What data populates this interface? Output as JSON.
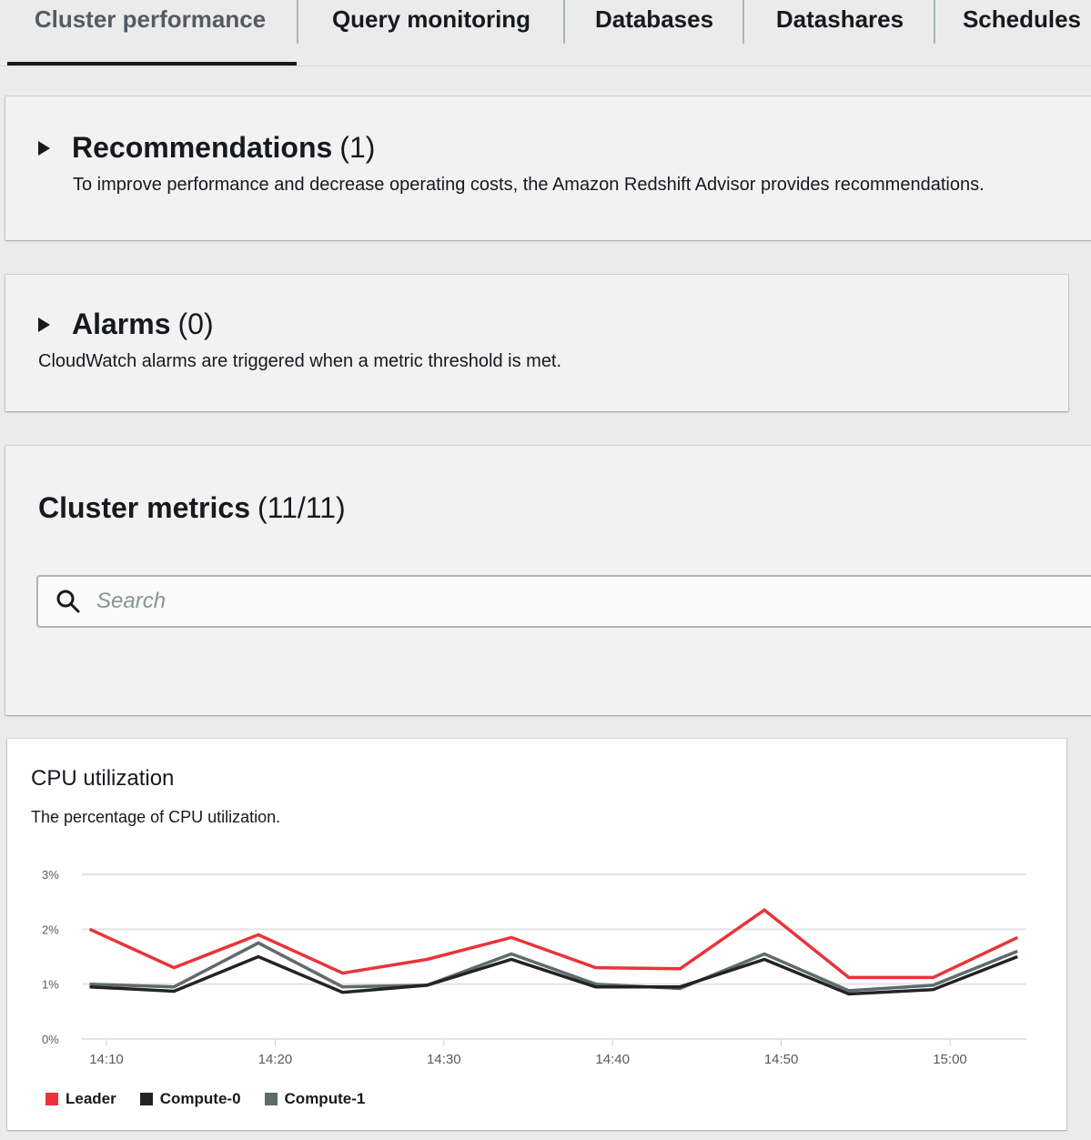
{
  "tabs": [
    {
      "label": "Cluster performance",
      "active": true
    },
    {
      "label": "Query monitoring",
      "active": false
    },
    {
      "label": "Databases",
      "active": false
    },
    {
      "label": "Datashares",
      "active": false
    },
    {
      "label": "Schedules",
      "active": false
    }
  ],
  "recommendations": {
    "title": "Recommendations",
    "count": "(1)",
    "description": "To improve performance and decrease operating costs, the Amazon Redshift Advisor provides recommendations."
  },
  "alarms": {
    "title": "Alarms",
    "count": "(0)",
    "description": "CloudWatch alarms are triggered when a metric threshold is met."
  },
  "cluster_metrics": {
    "title": "Cluster metrics",
    "count": "(11/11)",
    "search_placeholder": "Search"
  },
  "cpu_card": {
    "title": "CPU utilization",
    "description": "The percentage of CPU utilization."
  },
  "colors": {
    "leader": "#e8343a",
    "compute0": "#232323",
    "compute1": "#5f6b6d",
    "grid": "#e4e4e4",
    "axis_text": "#545b64"
  },
  "icons": {
    "search": "search-icon",
    "expand": "caret-right-icon"
  },
  "chart_data": {
    "type": "line",
    "title": "CPU utilization",
    "subtitle": "The percentage of CPU utilization.",
    "xlabel": "",
    "ylabel": "",
    "x": [
      "14:09",
      "14:14",
      "14:19",
      "14:24",
      "14:29",
      "14:34",
      "14:39",
      "14:44",
      "14:49",
      "14:54",
      "14:59",
      "15:04"
    ],
    "x_ticks": [
      "14:10",
      "14:20",
      "14:30",
      "14:40",
      "14:50",
      "15:00"
    ],
    "y_ticks": [
      "0%",
      "1%",
      "2%",
      "3%"
    ],
    "ylim": [
      0,
      3
    ],
    "grid": true,
    "legend_position": "bottom-left",
    "series": [
      {
        "name": "Leader",
        "values": [
          2.0,
          1.3,
          1.9,
          1.2,
          1.45,
          1.85,
          1.3,
          1.28,
          2.35,
          1.12,
          1.12,
          1.85
        ]
      },
      {
        "name": "Compute-0",
        "values": [
          0.95,
          0.87,
          1.5,
          0.85,
          0.98,
          1.45,
          0.95,
          0.95,
          1.45,
          0.82,
          0.9,
          1.5
        ]
      },
      {
        "name": "Compute-1",
        "values": [
          1.0,
          0.95,
          1.75,
          0.95,
          0.98,
          1.55,
          1.0,
          0.92,
          1.55,
          0.88,
          0.98,
          1.6
        ]
      }
    ]
  }
}
